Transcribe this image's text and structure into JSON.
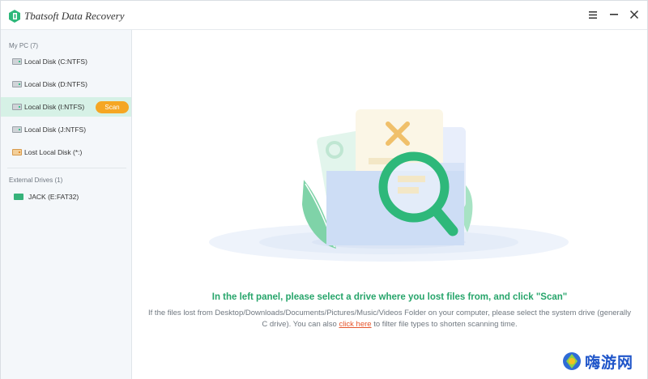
{
  "app": {
    "title": "Tbatsoft Data Recovery",
    "window_controls": {
      "menu_icon": "menu-icon",
      "minimize_icon": "minimize-icon",
      "close_icon": "close-icon"
    }
  },
  "sidebar": {
    "my_pc_label": "My PC (7)",
    "drives": [
      {
        "label": "Local Disk (C:NTFS)",
        "icon": "hard-disk-icon"
      },
      {
        "label": "Local Disk (D:NTFS)",
        "icon": "hard-disk-icon"
      },
      {
        "label": "Local Disk (I:NTFS)",
        "icon": "hard-disk-icon",
        "selected": true
      },
      {
        "label": "Local Disk (J:NTFS)",
        "icon": "hard-disk-icon"
      },
      {
        "label": "Lost Local Disk (*:)",
        "icon": "lost-disk-icon"
      }
    ],
    "scan_label": "Scan",
    "external_label": "External Drives (1)",
    "external_drives": [
      {
        "label": "JACK (E:FAT32)",
        "icon": "usb-drive-icon"
      }
    ]
  },
  "main": {
    "headline": "In the left panel, please select a drive where you lost files from, and click \"Scan\"",
    "description_part1": "If the files lost from Desktop/Downloads/Documents/Pictures/Music/Videos Folder on your computer, please select the system drive (generally C drive). You can also ",
    "link_text": "click here",
    "description_part2": " to filter file types to shorten scanning time."
  },
  "watermark": {
    "text": "嗨游网"
  },
  "colors": {
    "accent_green": "#27a56b",
    "scan_orange": "#f5a623",
    "selected_bg": "#d6f1e6",
    "link": "#e6552c"
  }
}
